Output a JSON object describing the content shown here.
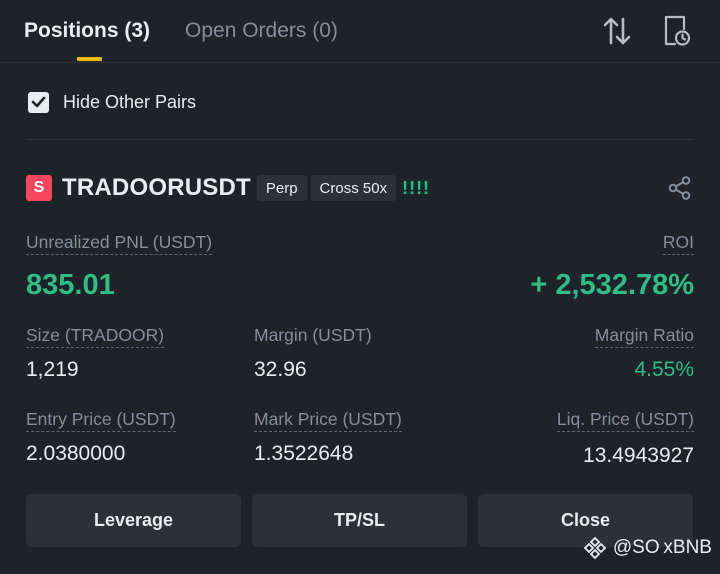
{
  "tabs": {
    "positions": "Positions (3)",
    "open_orders": "Open Orders (0)"
  },
  "filter": {
    "hide_other_pairs_label": "Hide Other Pairs",
    "hide_other_pairs_checked": true
  },
  "position": {
    "side_badge": "S",
    "symbol": "TRADOORUSDT",
    "contract_type": "Perp",
    "margin_mode": "Cross 50x",
    "signal": "!!!!",
    "unrealized_pnl_label": "Unrealized PNL (USDT)",
    "unrealized_pnl_value": "835.01",
    "roi_label": "ROI",
    "roi_value": "+ 2,532.78%",
    "size_label": "Size (TRADOOR)",
    "size_value": "1,219",
    "margin_label": "Margin (USDT)",
    "margin_value": "32.96",
    "margin_ratio_label": "Margin Ratio",
    "margin_ratio_value": "4.55%",
    "entry_price_label": "Entry Price (USDT)",
    "entry_price_value": "2.0380000",
    "mark_price_label": "Mark Price (USDT)",
    "mark_price_value": "1.3522648",
    "liq_price_label": "Liq. Price (USDT)",
    "liq_price_value": "13.4943927"
  },
  "actions": {
    "leverage": "Leverage",
    "tpsl": "TP/SL",
    "close": "Close"
  },
  "watermark": "@SO xBNB",
  "icons": {
    "sort": "sort-arrows-icon",
    "history": "document-clock-icon",
    "share": "share-icon",
    "checkbox": "checkmark-icon",
    "brand": "binance-square-icon"
  },
  "colors": {
    "background": "#1e2329",
    "accent": "#f0b90b",
    "positive": "#2ebd85",
    "short": "#f6465d",
    "muted": "#848e9c"
  }
}
